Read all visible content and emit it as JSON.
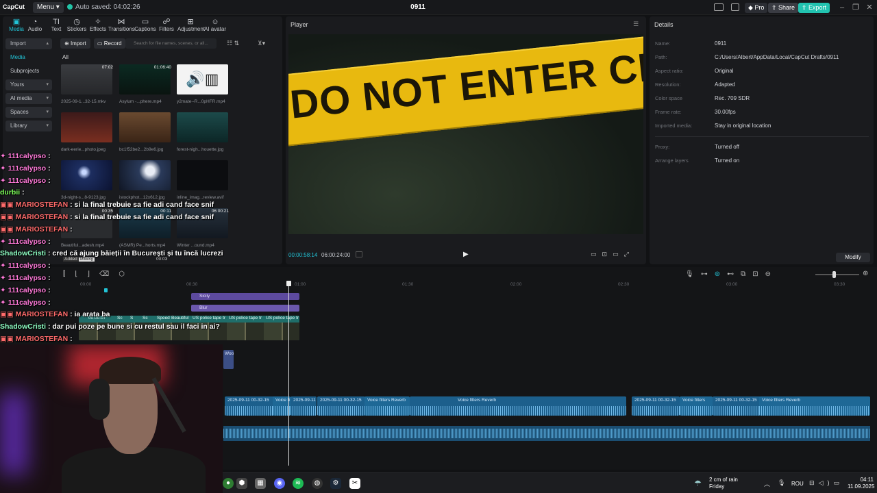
{
  "titlebar": {
    "logo": "CapCut",
    "menu": "Menu",
    "autosave": "Auto saved: 04:02:26",
    "project": "0911",
    "pro": "Pro",
    "share": "Share",
    "export": "Export"
  },
  "toolbar": {
    "tools": [
      "Media",
      "Audio",
      "Text",
      "Stickers",
      "Effects",
      "Transitions",
      "Captions",
      "Filters",
      "Adjustment",
      "AI avatar"
    ]
  },
  "sidenav": {
    "import": "Import",
    "media": "Media",
    "subprojects": "Subprojects",
    "yours": "Yours",
    "ai_media": "AI media",
    "spaces": "Spaces",
    "library": "Library"
  },
  "media": {
    "import_btn": "Import",
    "record_btn": "Record",
    "search_placeholder": "Search for file names, scenes, or all...",
    "all": "All",
    "items": [
      {
        "label": "2025-09-1...32-15.mkv",
        "duration": "07:02"
      },
      {
        "label": "Asylum -...phere.mp4",
        "duration": "01:06:40"
      },
      {
        "label": "y2mate--R...0pHFR.mp4",
        "duration": ""
      },
      {
        "label": "dark-eerie...photo.jpeg",
        "duration": ""
      },
      {
        "label": "bc1f52be2...2b9e6.jpg",
        "duration": ""
      },
      {
        "label": "forest-nigh...houette.jpg",
        "duration": ""
      },
      {
        "label": "3d-night-s...8-9123.jpg",
        "duration": ""
      },
      {
        "label": "istockphot...12x612.jpg",
        "duration": ""
      },
      {
        "label": "inline_imag...review.avif",
        "duration": ""
      },
      {
        "label": "Beautiful...adesh.mp4",
        "duration": "00:35"
      },
      {
        "label": "(ASMR) Pe...horts.mp4",
        "duration": "00:11"
      },
      {
        "label": "Winter ...ound.mp4",
        "duration": "06:00:21"
      }
    ],
    "added": "Added",
    "missing": "Missing",
    "small_dur": "00:03"
  },
  "player": {
    "title": "Player",
    "current_time": "00:00:58:14",
    "total_time": "06:00:24:00",
    "tape_text": "DO NOT ENTER CRIME SC"
  },
  "details": {
    "title": "Details",
    "rows": [
      {
        "k": "Name:",
        "v": "0911"
      },
      {
        "k": "Path:",
        "v": "C:/Users/Albert/AppData/Local/CapCut Drafts/0911"
      },
      {
        "k": "Aspect ratio:",
        "v": "Original"
      },
      {
        "k": "Resolution:",
        "v": "Adapted"
      },
      {
        "k": "Color space",
        "v": "Rec. 709 SDR"
      },
      {
        "k": "Frame rate:",
        "v": "30.00fps"
      },
      {
        "k": "Imported media:",
        "v": "Stay in original location"
      },
      {
        "k": "Proxy:",
        "v": "Turned off"
      },
      {
        "k": "Arrange layers",
        "v": "Turned on"
      }
    ],
    "modify": "Modify"
  },
  "timeline": {
    "ruler": [
      "00:00",
      "00:30",
      "01:00",
      "01:30",
      "02:00",
      "02:30",
      "03:00",
      "03:30"
    ],
    "fx1": "Sicily",
    "fx2": "Blur",
    "main_clips": [
      "00:00:07",
      "Sc",
      "S",
      "Sc",
      "Speed",
      "Beautiful",
      "US police tape tr",
      "US police tape tr",
      "US police tape tr"
    ],
    "woo": "Woo",
    "audio_clips": [
      "2025-09-11 00-32-15",
      "Voice fi",
      "2025-09-11",
      "2025-09-11 00-32-15",
      "Voice filters Reverb",
      "Voice filters Reverb",
      "2025-09-11 00-32-15",
      "Voice filters",
      "2025-09-11 00-32-15",
      "Voice filters Reverb"
    ]
  },
  "chat": [
    {
      "name": "111calypso",
      "msg": " :",
      "color": "#ff7ad9"
    },
    {
      "name": "111calypso",
      "msg": " :",
      "color": "#ff7ad9"
    },
    {
      "name": "111calypso",
      "msg": " :",
      "color": "#ff7ad9"
    },
    {
      "name": "durbii",
      "msg": " :",
      "color": "#7dff5a"
    },
    {
      "name": "MARIOSTEFAN",
      "msg": " : si la final trebuie sa fie adi cand face snif",
      "color": "#ff6b6b"
    },
    {
      "name": "MARIOSTEFAN",
      "msg": " : si la final trebuie sa fie adi cand face snif",
      "color": "#ff6b6b"
    },
    {
      "name": "MARIOSTEFAN",
      "msg": " :",
      "color": "#ff6b6b"
    },
    {
      "name": "111calypso",
      "msg": " :",
      "color": "#ff7ad9"
    },
    {
      "name": "ShadowCristi",
      "msg": " : cred că ajung băieții în București și tu încă lucrezi",
      "color": "#8fffc4"
    },
    {
      "name": "111calypso",
      "msg": " :",
      "color": "#ff7ad9"
    },
    {
      "name": "111calypso",
      "msg": " :",
      "color": "#ff7ad9"
    },
    {
      "name": "111calypso",
      "msg": " :",
      "color": "#ff7ad9"
    },
    {
      "name": "111calypso",
      "msg": " :",
      "color": "#ff7ad9"
    },
    {
      "name": "MARIOSTEFAN",
      "msg": " : ia arata ba",
      "color": "#ff6b6b"
    },
    {
      "name": "ShadowCristi",
      "msg": " : dar pui poze pe bune si cu restul sau il faci in ai?",
      "color": "#8fffc4"
    },
    {
      "name": "MARIOSTEFAN",
      "msg": " :",
      "color": "#ff6b6b"
    }
  ],
  "taskbar": {
    "weather_line1": "2 cm of rain",
    "weather_line2": "Friday",
    "lang": "ROU",
    "time": "04:11",
    "date": "11.09.2025"
  }
}
